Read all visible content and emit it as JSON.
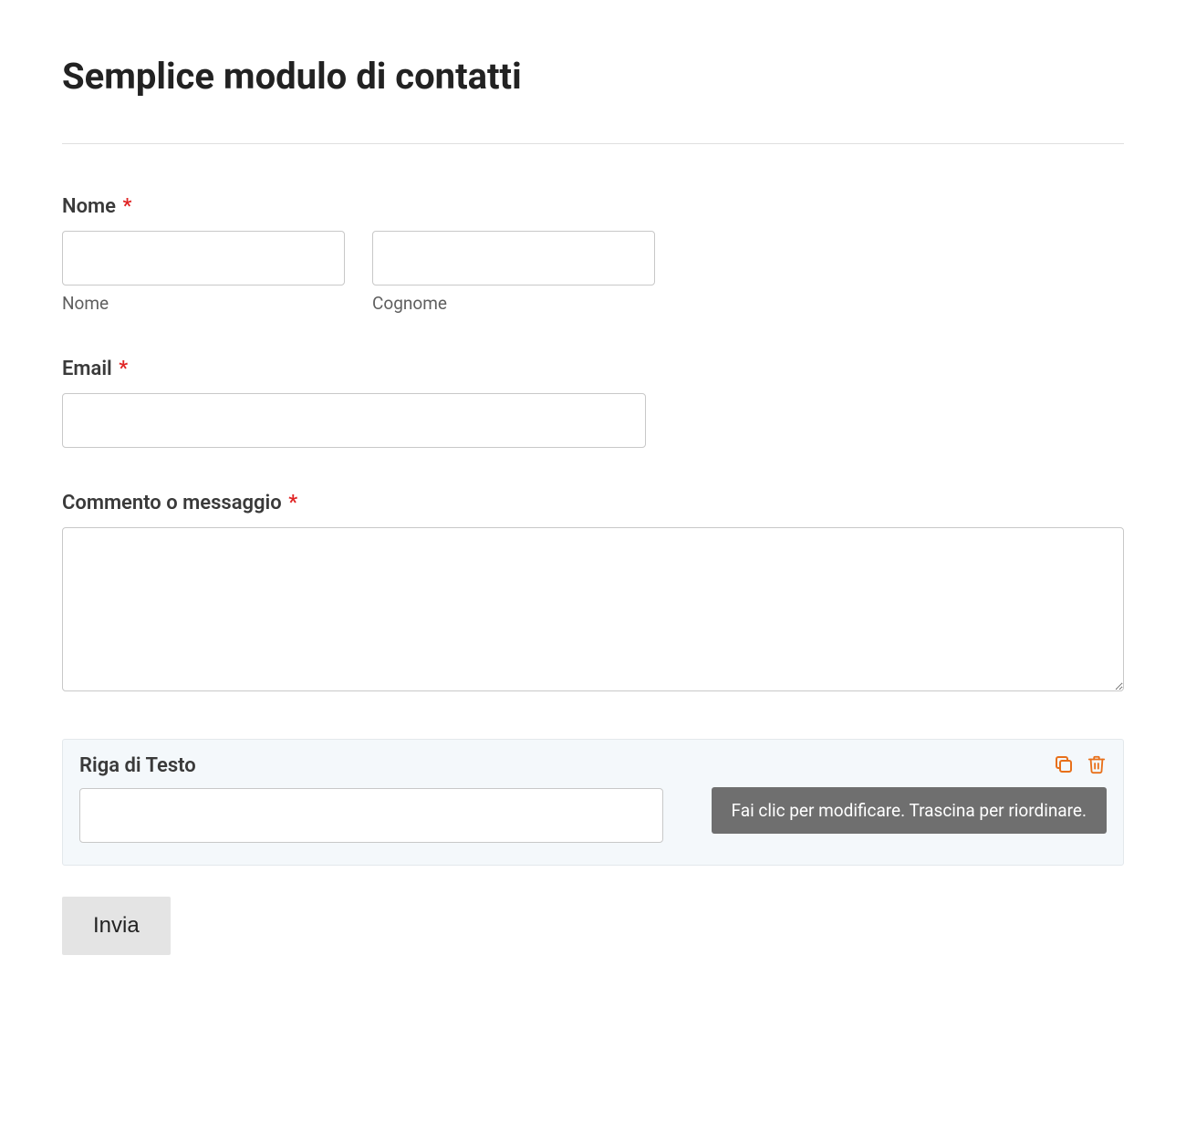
{
  "title": "Semplice modulo di contatti",
  "required_marker": "*",
  "fields": {
    "name": {
      "label": "Nome",
      "required": true,
      "first_sublabel": "Nome",
      "last_sublabel": "Cognome",
      "first_value": "",
      "last_value": ""
    },
    "email": {
      "label": "Email",
      "required": true,
      "value": ""
    },
    "message": {
      "label": "Commento o messaggio",
      "required": true,
      "value": ""
    }
  },
  "builder_block": {
    "label": "Riga di Testo",
    "tooltip": "Fai clic per modificare. Trascina per riordinare.",
    "value": ""
  },
  "submit": {
    "label": "Invia"
  }
}
